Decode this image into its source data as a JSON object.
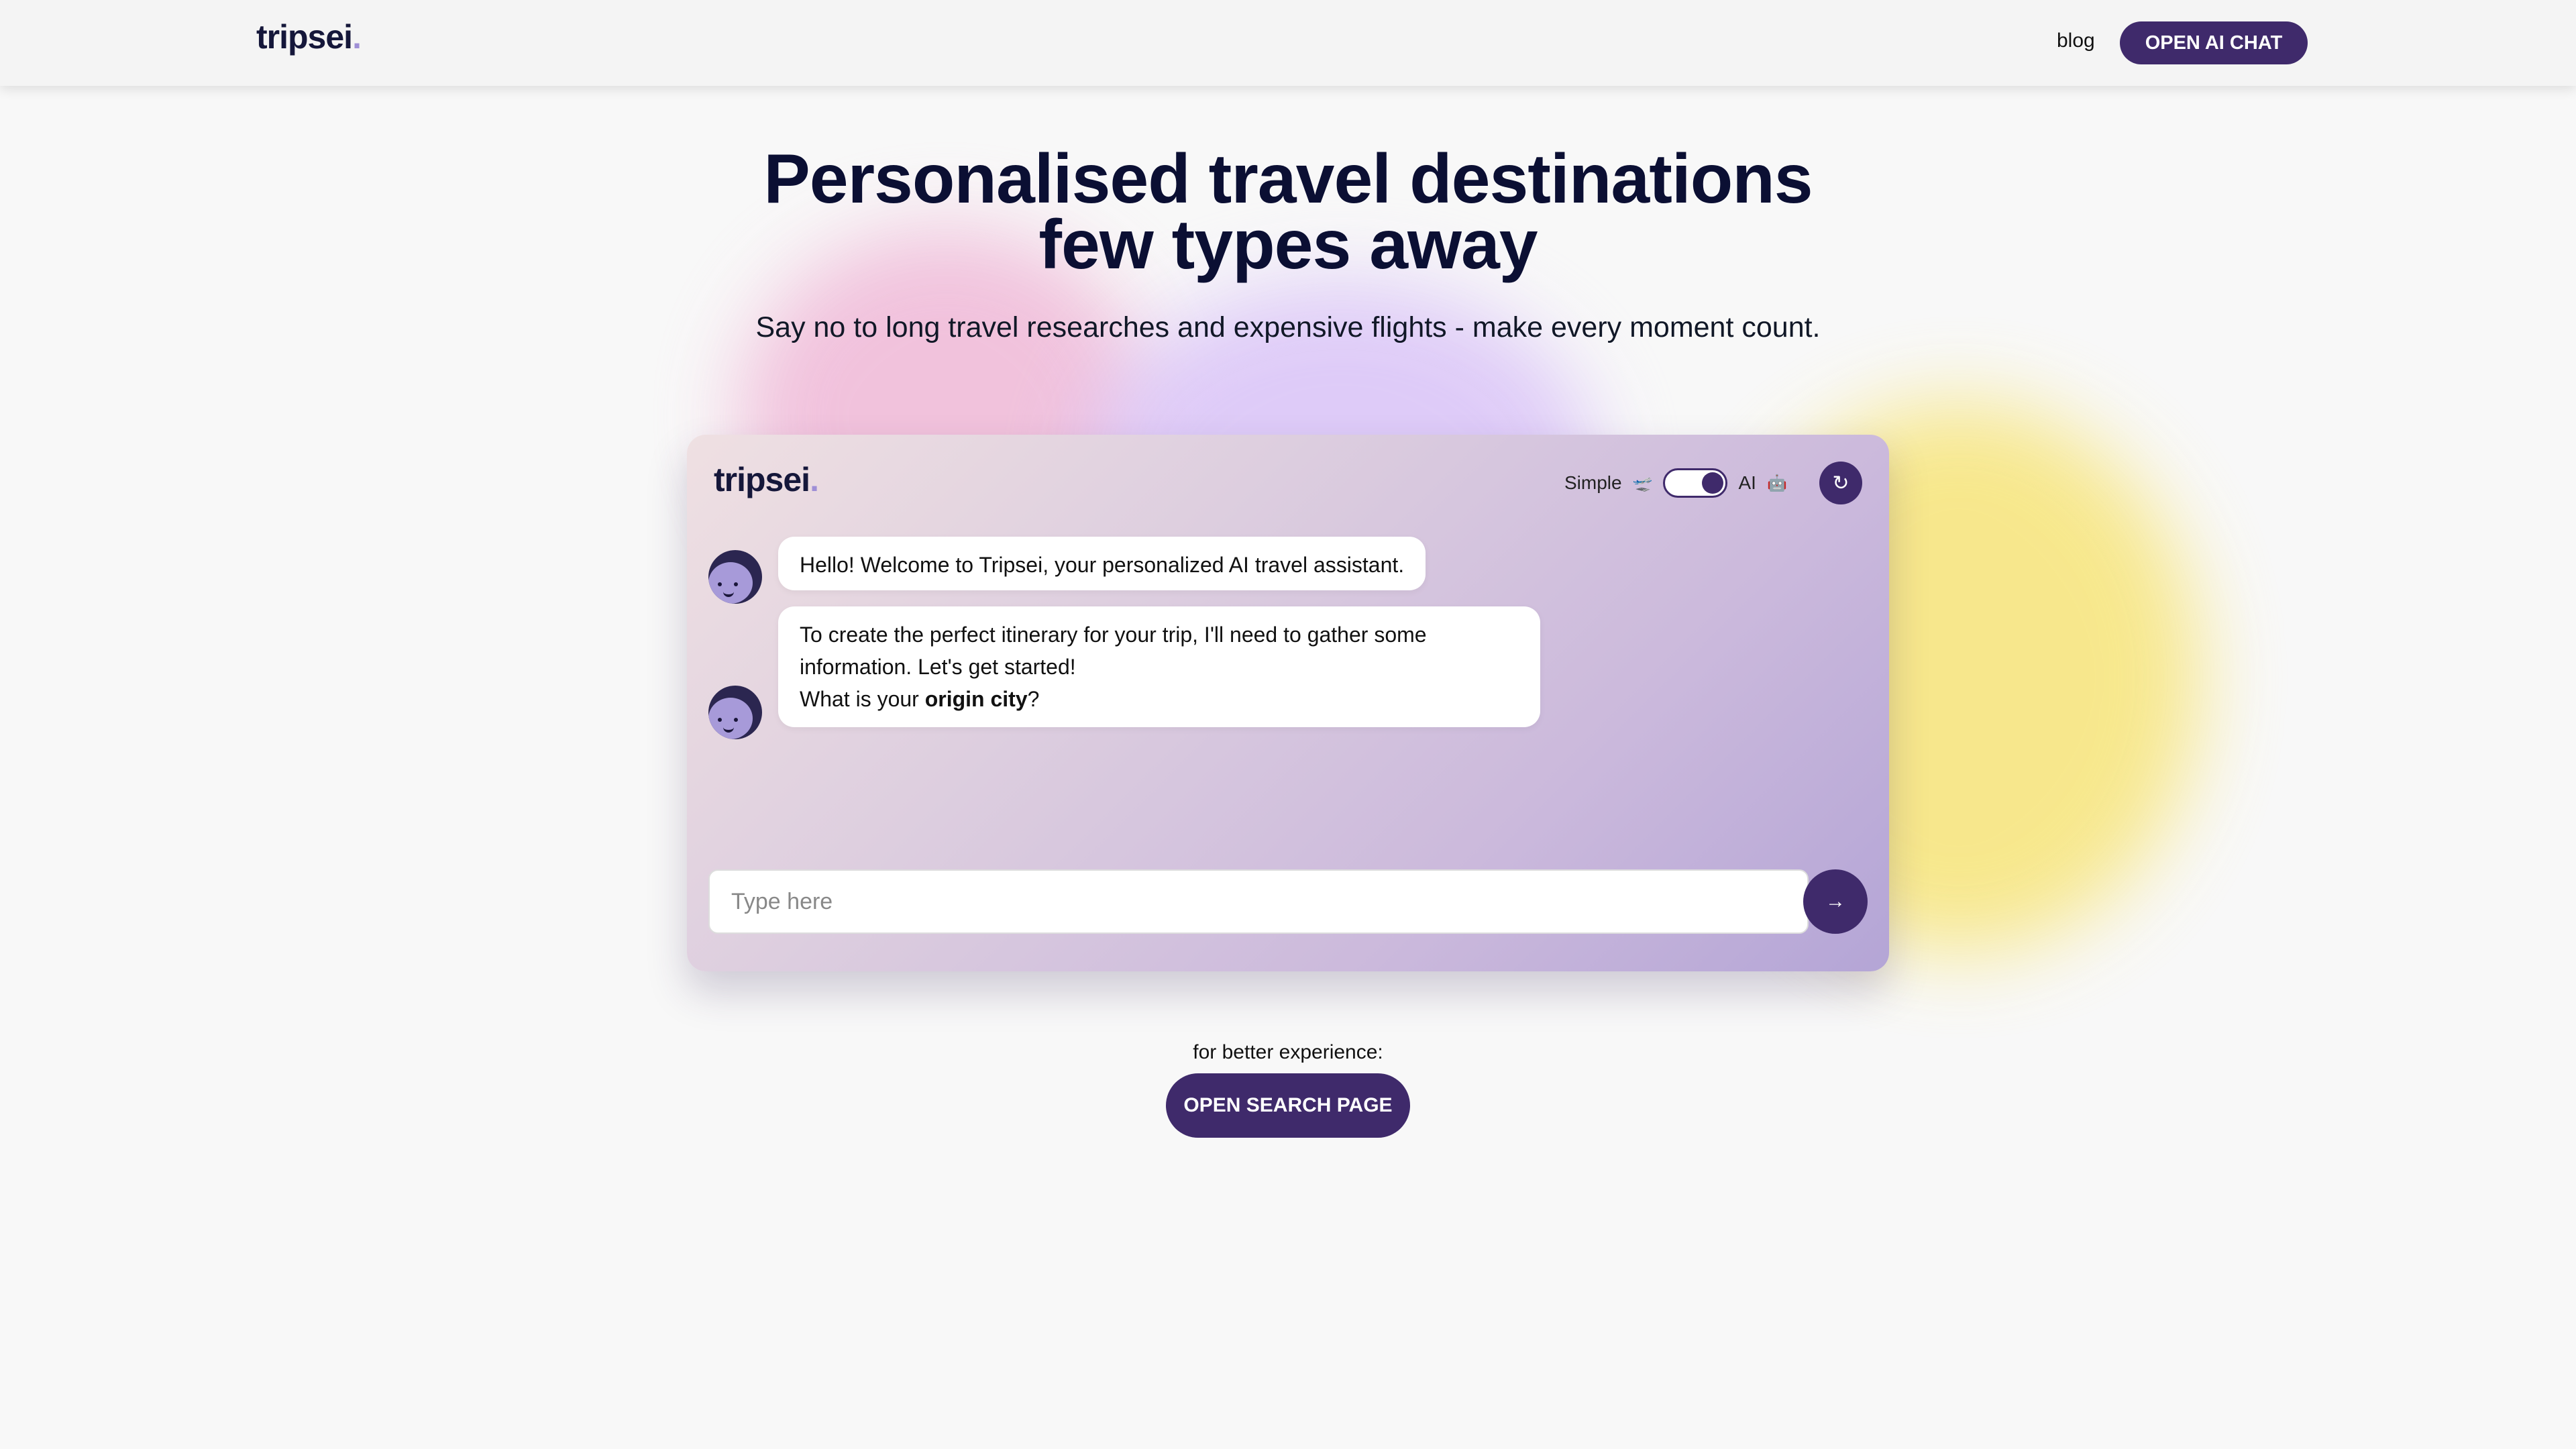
{
  "nav": {
    "logo": "tripsei",
    "logo_dot": ".",
    "blog_link": "blog",
    "cta_label": "OPEN AI CHAT"
  },
  "hero": {
    "title_line1": "Personalised travel destinations",
    "title_line2": "few types away",
    "subtitle": "Say no to long travel researches and expensive flights - make every moment count."
  },
  "chat": {
    "logo": "tripsei",
    "logo_dot": ".",
    "mode_simple_label": "Simple",
    "mode_simple_icon": "🛫",
    "mode_ai_label": "AI",
    "mode_ai_icon": "🤖",
    "mode_selected": "AI",
    "refresh_icon": "↻",
    "messages": [
      {
        "text": "Hello! Welcome to Tripsei, your personalized AI travel assistant."
      },
      {
        "line1": "To create the perfect itinerary for your trip, I'll need to gather some",
        "line2": "information. Let's get started!",
        "line3_prefix": "What is your ",
        "line3_bold": "origin city",
        "line3_suffix": "?"
      }
    ],
    "input_placeholder": "Type here",
    "input_value": "",
    "send_icon": "→"
  },
  "footer": {
    "better_text": "for better experience:",
    "search_cta": "OPEN SEARCH PAGE"
  },
  "colors": {
    "primary": "#3f2a6b",
    "background": "#f8f8f8",
    "heading": "#0b0f33",
    "blob_pink": "#f0b9d8",
    "blob_violet": "#dcc7f8",
    "blob_yellow": "#f7e57a"
  }
}
